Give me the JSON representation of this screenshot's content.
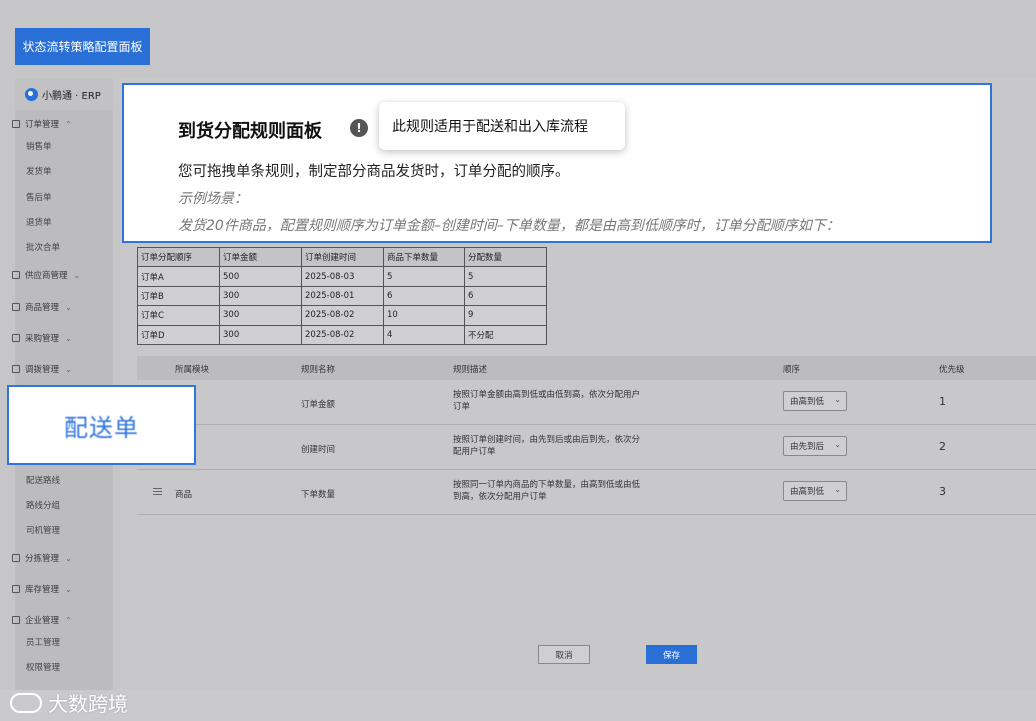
{
  "banner": {
    "title": "状态流转策略配置面板"
  },
  "sidebar": {
    "brand": "小鹏通 · ERP",
    "groups": [
      {
        "label": "订单管理",
        "chevron": "⌃"
      },
      {
        "label": "供应商管理",
        "chevron": "⌄"
      },
      {
        "label": "商品管理",
        "chevron": "⌄"
      },
      {
        "label": "采购管理",
        "chevron": "⌄"
      },
      {
        "label": "调拨管理",
        "chevron": "⌄"
      },
      {
        "label": "分拣管理",
        "chevron": "⌄"
      },
      {
        "label": "库存管理",
        "chevron": "⌄"
      },
      {
        "label": "企业管理",
        "chevron": "⌃"
      }
    ],
    "subs": [
      "销售单",
      "发货单",
      "售后单",
      "退货单",
      "批次合单",
      "配送路线",
      "路线分组",
      "司机管理",
      "员工管理",
      "权限管理"
    ]
  },
  "overlay": {
    "heading": "到货分配规则面板",
    "info_icon": "!",
    "tooltip": "此规则适用于配送和出入库流程",
    "description": "您可拖拽单条规则，制定部分商品发货时，订单分配的顺序。",
    "example_title": "示例场景：",
    "example_text": "发货20件商品，配置规则顺序为订单金额–创建时间–下单数量，都是由高到低顺序时，订单分配顺序如下："
  },
  "order_table": {
    "headers": [
      "订单分配顺序",
      "订单金额",
      "订单创建时间",
      "商品下单数量",
      "分配数量"
    ],
    "rows": [
      [
        "订单A",
        "500",
        "2025-08-03",
        "5",
        "5"
      ],
      [
        "订单B",
        "300",
        "2025-08-01",
        "6",
        "6"
      ],
      [
        "订单C",
        "300",
        "2025-08-02",
        "10",
        "9"
      ],
      [
        "订单D",
        "300",
        "2025-08-02",
        "4",
        "不分配"
      ]
    ]
  },
  "rules": {
    "headers": {
      "module": "所属模块",
      "name": "规则名称",
      "desc": "规则描述",
      "order": "顺序",
      "priority": "优先级"
    },
    "rows": [
      {
        "module": "",
        "name": "订单金额",
        "desc": "按照订单金额由高到低或由低到高，依次分配用户订单",
        "order": "由高到低",
        "priority": "1"
      },
      {
        "module": "",
        "name": "创建时间",
        "desc": "按照订单创建时间，由先到后或由后到先，依次分配用户订单",
        "order": "由先到后",
        "priority": "2"
      },
      {
        "module": "商品",
        "name": "下单数量",
        "desc": "按照同一订单内商品的下单数量，由高到低或由低到高，依次分配用户订单",
        "order": "由高到低",
        "priority": "3"
      }
    ]
  },
  "callout": {
    "label": "配送单"
  },
  "buttons": {
    "cancel": "取消",
    "save": "保存"
  },
  "watermark": {
    "text": "大数跨境"
  },
  "colors": {
    "accent": "#2a6fd6",
    "highlight_border": "#2f74e0"
  }
}
